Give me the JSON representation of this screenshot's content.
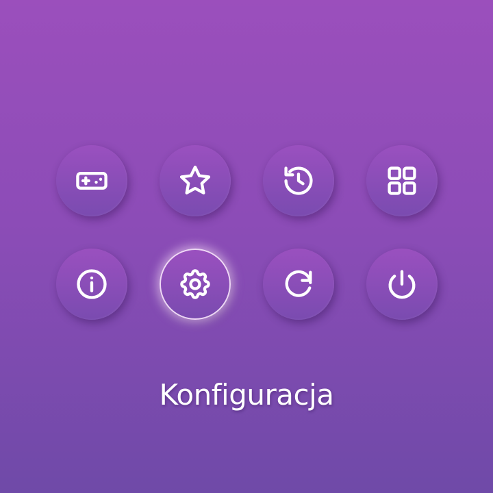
{
  "menu": {
    "selected_label": "Konfiguracja",
    "selected_index": 5,
    "buttons": [
      {
        "icon": "gamepad-icon"
      },
      {
        "icon": "star-icon"
      },
      {
        "icon": "history-icon"
      },
      {
        "icon": "grid-icon"
      },
      {
        "icon": "info-icon"
      },
      {
        "icon": "gear-icon"
      },
      {
        "icon": "refresh-icon"
      },
      {
        "icon": "power-icon"
      }
    ]
  },
  "colors": {
    "background_top": "#9b4fbc",
    "background_bottom": "#6f4aa8",
    "icon": "#ffffff",
    "selected_ring": "#fff0ff"
  }
}
